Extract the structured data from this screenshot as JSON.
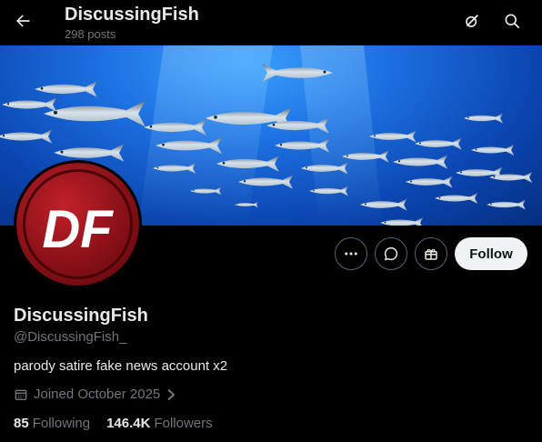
{
  "header": {
    "title": "DiscussingFish",
    "posts_count": "298 posts"
  },
  "profile": {
    "name": "DiscussingFish",
    "handle": "@DiscussingFish_",
    "bio": "parody satire fake news account x2",
    "joined": "Joined October 2025",
    "following_count": "85",
    "following_label": "Following",
    "followers_count": "146.4K",
    "followers_label": "Followers",
    "avatar_logo": "DF"
  },
  "actions": {
    "follow_label": "Follow"
  },
  "icons": {
    "back": "arrow-left-icon",
    "grok": "grok-icon",
    "search": "search-icon",
    "more": "more-icon",
    "message": "message-icon",
    "gift": "gift-icon",
    "calendar": "calendar-icon",
    "chevron": "chevron-right-icon"
  },
  "colors": {
    "background": "#000000",
    "follow_bg": "#eff3f4",
    "muted_text": "#71767b",
    "avatar_red": "#a8141c"
  }
}
